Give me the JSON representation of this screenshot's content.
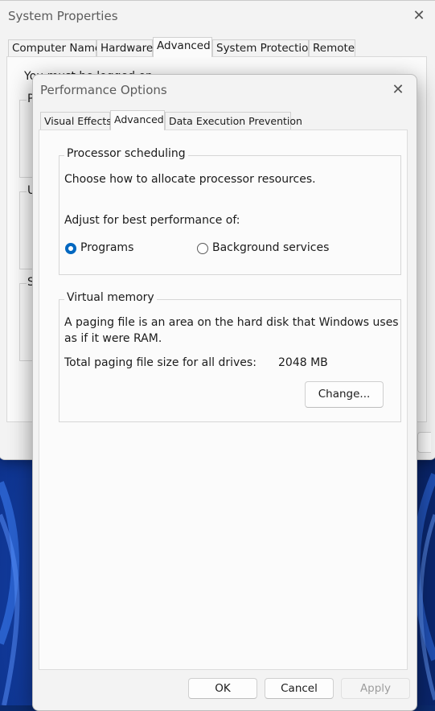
{
  "system_properties": {
    "title": "System Properties",
    "tabs": [
      "Computer Name",
      "Hardware",
      "Advanced",
      "System Protection",
      "Remote"
    ],
    "active_tab": "Advanced",
    "intro_partial": "You must be logged on as an Administrator to make most of these changes.",
    "group_initials": [
      "P",
      "U",
      "S"
    ]
  },
  "performance_options": {
    "title": "Performance Options",
    "tabs": [
      "Visual Effects",
      "Advanced",
      "Data Execution Prevention"
    ],
    "active_tab": "Advanced",
    "processor_scheduling": {
      "legend": "Processor scheduling",
      "description": "Choose how to allocate processor resources.",
      "adjust_label": "Adjust for best performance of:",
      "options": [
        "Programs",
        "Background services"
      ],
      "selected": "Programs"
    },
    "virtual_memory": {
      "legend": "Virtual memory",
      "description_line1": "A paging file is an area on the hard disk that Windows uses",
      "description_line2": "as if it were RAM.",
      "total_label": "Total paging file size for all drives:",
      "total_value": "2048 MB",
      "change_button": "Change..."
    },
    "buttons": {
      "ok": "OK",
      "cancel": "Cancel",
      "apply": "Apply"
    }
  },
  "colors": {
    "accent": "#0067c0",
    "wallpaper": "#0b2a6e"
  },
  "icons": {
    "close": "close-icon"
  }
}
